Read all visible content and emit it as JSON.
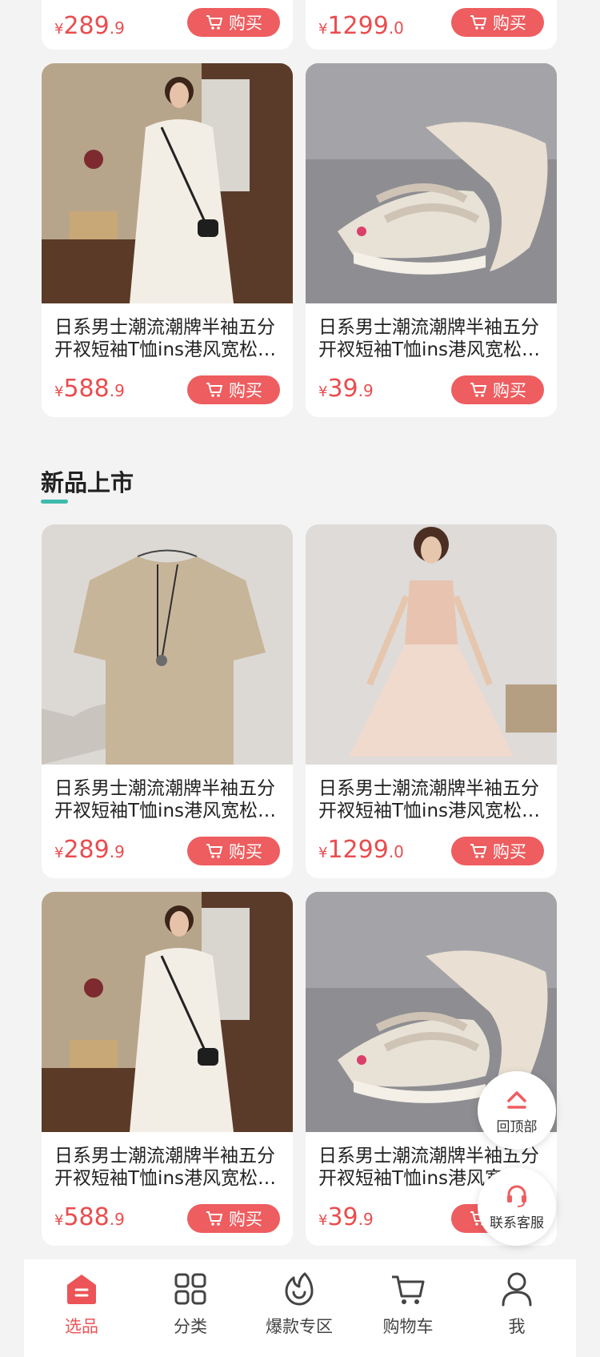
{
  "colors": {
    "accent": "#ee5d5f",
    "price": "#e94d4f",
    "underline": "#3fb9ad",
    "background": "#f3f3f3"
  },
  "top_row": [
    {
      "currency": "¥",
      "price_int": "289",
      "price_dec": ".9",
      "button": "购买"
    },
    {
      "currency": "¥",
      "price_int": "1299",
      "price_dec": ".0",
      "button": "购买"
    }
  ],
  "hot_products": [
    {
      "image": "woman-white-dress-photo",
      "title": "日系男士潮流潮牌半袖五分开衩短袖T恤ins港风宽松白色T恤",
      "currency": "¥",
      "price_int": "588",
      "price_dec": ".9",
      "button": "购买"
    },
    {
      "image": "platform-sandals-photo",
      "title": "日系男士潮流潮牌半袖五分开衩短袖T恤ins港风宽松白色T恤",
      "currency": "¥",
      "price_int": "39",
      "price_dec": ".9",
      "button": "购买"
    }
  ],
  "new_section": {
    "title": "新品上市"
  },
  "new_products": [
    {
      "image": "beige-tshirt-photo",
      "title": "日系男士潮流潮牌半袖五分开衩短袖T恤ins港风宽松白色T恤",
      "currency": "¥",
      "price_int": "289",
      "price_dec": ".9",
      "button": "购买"
    },
    {
      "image": "pink-tulle-dress-photo",
      "title": "日系男士潮流潮牌半袖五分开衩短袖T恤ins港风宽松白色T恤",
      "currency": "¥",
      "price_int": "1299",
      "price_dec": ".0",
      "button": "购买"
    },
    {
      "image": "woman-white-dress-photo",
      "title": "日系男士潮流潮牌半袖五分开衩短袖T恤ins港风宽松白色T恤",
      "currency": "¥",
      "price_int": "588",
      "price_dec": ".9",
      "button": "购买"
    },
    {
      "image": "platform-sandals-photo",
      "title": "日系男士潮流潮牌半袖五分开衩短袖T恤ins港风宽松白色T恤",
      "currency": "¥",
      "price_int": "39",
      "price_dec": ".9",
      "button": "购买"
    }
  ],
  "floating": {
    "back_to_top": "回顶部",
    "customer_service": "联系客服"
  },
  "tabbar": [
    {
      "label": "选品",
      "icon": "home-icon",
      "active": true
    },
    {
      "label": "分类",
      "icon": "grid-icon",
      "active": false
    },
    {
      "label": "爆款专区",
      "icon": "flame-icon",
      "active": false
    },
    {
      "label": "购物车",
      "icon": "cart-icon",
      "active": false
    },
    {
      "label": "我",
      "icon": "user-icon",
      "active": false
    }
  ]
}
